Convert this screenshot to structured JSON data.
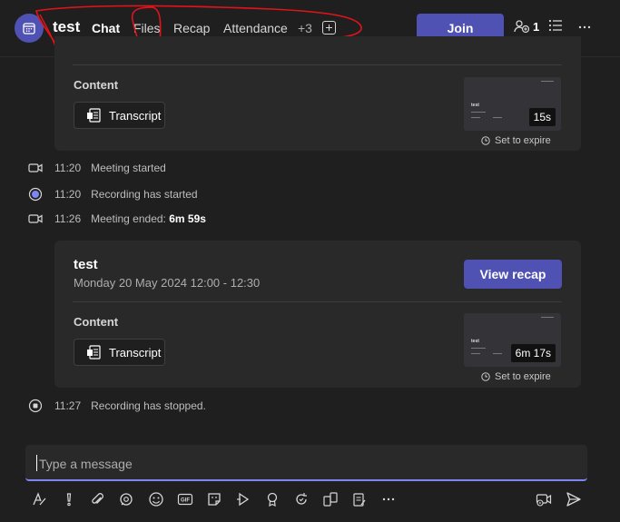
{
  "header": {
    "title": "test",
    "tabs": [
      {
        "label": "Chat",
        "active": true
      },
      {
        "label": "Files",
        "active": false
      },
      {
        "label": "Recap",
        "active": false
      },
      {
        "label": "Attendance",
        "active": false
      }
    ],
    "more_tabs": "+3",
    "join_label": "Join",
    "participants_count": "1"
  },
  "meeting_cards": [
    {
      "content_label": "Content",
      "transcript_label": "Transcript",
      "duration": "15s",
      "expire_label": "Set to expire"
    },
    {
      "title": "test",
      "datetime": "Monday 20 May 2024 12:00 - 12:30",
      "view_recap_label": "View recap",
      "content_label": "Content",
      "transcript_label": "Transcript",
      "duration": "6m 17s",
      "expire_label": "Set to expire"
    }
  ],
  "events": [
    {
      "time": "11:20",
      "text": "Meeting started",
      "icon": "video-camera-icon"
    },
    {
      "time": "11:20",
      "text": "Recording has started",
      "icon": "recording-icon"
    },
    {
      "time": "11:26",
      "text": "Meeting ended:",
      "bold": "6m 59s",
      "icon": "video-camera-icon"
    },
    {
      "time": "11:27",
      "text": "Recording has stopped.",
      "icon": "stop-recording-icon"
    }
  ],
  "compose": {
    "placeholder": "Type a message"
  },
  "toolbar": [
    "format-icon",
    "priority-icon",
    "attach-icon",
    "loop-icon",
    "emoji-icon",
    "gif-icon",
    "sticker-icon",
    "forms-icon",
    "praise-icon",
    "update-icon",
    "apps-icon",
    "approvals-icon",
    "more-icon",
    "video-clip-icon",
    "send-icon"
  ],
  "colors": {
    "accent": "#4f52b2",
    "accent_light": "#7f85f5",
    "background": "#1f1f1f",
    "card": "#292929",
    "annotation": "#e0141a"
  }
}
